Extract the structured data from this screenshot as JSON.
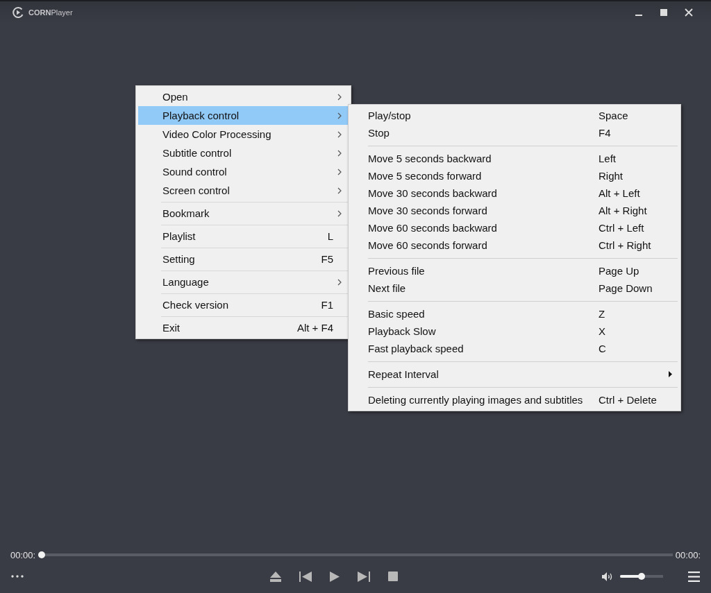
{
  "window": {
    "title": "**CORN**Player"
  },
  "main_menu": {
    "groups": [
      [
        {
          "label": "Open",
          "submenu": true,
          "selected": false
        },
        {
          "label": "Playback control",
          "submenu": true,
          "selected": true
        },
        {
          "label": "Video Color Processing",
          "submenu": true,
          "selected": false
        },
        {
          "label": "Subtitle control",
          "submenu": true,
          "selected": false
        },
        {
          "label": "Sound control",
          "submenu": true,
          "selected": false
        },
        {
          "label": "Screen control",
          "submenu": true,
          "selected": false
        }
      ],
      [
        {
          "label": "Bookmark",
          "submenu": true,
          "selected": false
        }
      ],
      [
        {
          "label": "Playlist",
          "shortcut": "L",
          "submenu": false,
          "selected": false
        }
      ],
      [
        {
          "label": "Setting",
          "shortcut": "F5",
          "submenu": false,
          "selected": false
        }
      ],
      [
        {
          "label": "Language",
          "submenu": true,
          "selected": false
        }
      ],
      [
        {
          "label": "Check version",
          "shortcut": "F1",
          "submenu": false,
          "selected": false
        }
      ],
      [
        {
          "label": "Exit",
          "shortcut": "Alt + F4",
          "submenu": false,
          "selected": false
        }
      ]
    ]
  },
  "playback_submenu": {
    "groups": [
      [
        {
          "label": "Play/stop",
          "shortcut": "Space",
          "submenu": false
        },
        {
          "label": "Stop",
          "shortcut": "F4",
          "submenu": false
        }
      ],
      [
        {
          "label": "Move 5 seconds backward",
          "shortcut": "Left",
          "submenu": false
        },
        {
          "label": "Move 5 seconds forward",
          "shortcut": "Right",
          "submenu": false
        },
        {
          "label": "Move 30 seconds backward",
          "shortcut": "Alt + Left",
          "submenu": false
        },
        {
          "label": "Move 30 seconds forward",
          "shortcut": "Alt + Right",
          "submenu": false
        },
        {
          "label": "Move 60 seconds backward",
          "shortcut": "Ctrl + Left",
          "submenu": false
        },
        {
          "label": "Move 60 seconds forward",
          "shortcut": "Ctrl + Right",
          "submenu": false
        }
      ],
      [
        {
          "label": "Previous file",
          "shortcut": "Page Up",
          "submenu": false
        },
        {
          "label": "Next file",
          "shortcut": "Page Down",
          "submenu": false
        }
      ],
      [
        {
          "label": "Basic speed",
          "shortcut": "Z",
          "submenu": false
        },
        {
          "label": "Playback Slow",
          "shortcut": "X",
          "submenu": false
        },
        {
          "label": "Fast playback speed",
          "shortcut": "C",
          "submenu": false
        }
      ],
      [
        {
          "label": "Repeat Interval",
          "submenu": true
        }
      ],
      [
        {
          "label": "Deleting currently playing images and subtitles",
          "shortcut": "Ctrl + Delete",
          "submenu": false
        }
      ]
    ]
  },
  "seek": {
    "elapsed": "00:00:",
    "total": "00:00:",
    "level": 0
  },
  "volume": {
    "level": 0.5
  }
}
